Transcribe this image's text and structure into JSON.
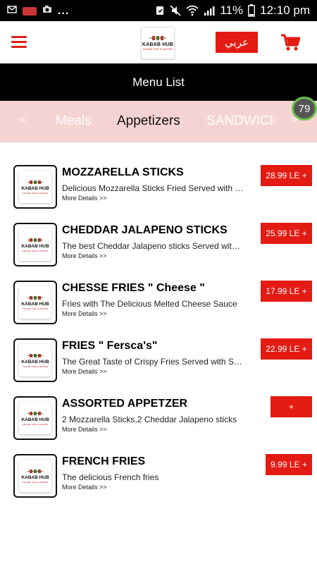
{
  "status_bar": {
    "battery": "11%",
    "time": "12:10 pm",
    "overflow": "..."
  },
  "header": {
    "logo_title": "KABAB HUB",
    "logo_tagline": "CHASE THE FLAVORS",
    "language_button": "عربي"
  },
  "title_bar": {
    "title": "Menu List"
  },
  "tabs": {
    "prev": "<",
    "next": ">",
    "items": [
      "Meals",
      "Appetizers",
      "SANDWICH"
    ],
    "selected": "Appetizers",
    "badge": "79"
  },
  "menu_items": [
    {
      "name": "MOZZARELLA STICKS",
      "description": "Delicious Mozzarella Sticks Fried Served with Ranch Sauce",
      "more": "More Details >>",
      "price": "28.99 LE +"
    },
    {
      "name": "CHEDDAR JALAPENO STICKS",
      "description": "The best Cheddar Jalapeno sticks Served with Ranch Sauce",
      "more": "More Details >>",
      "price": "25.99 LE +"
    },
    {
      "name": "CHESSE FRIES \" Cheese \"",
      "description": "Fries with The Delicious Melted Cheese Sauce",
      "more": "More Details >>",
      "price": "17.99 LE +"
    },
    {
      "name": "FRIES \" Fersca's\"",
      "description": "The Great Taste of Crispy Fries Served with Sauce",
      "more": "More Details >>",
      "price": "22.99 LE +"
    },
    {
      "name": "ASSORTED APPETZER",
      "description": "2 Mozzarella Sticks,2 Cheddar Jalapeno sticks",
      "more": "More Details >>",
      "price": "+"
    },
    {
      "name": "FRENCH FRIES",
      "description": "The delicious French fries",
      "more": "More Details >>",
      "price": "9.99 LE +"
    }
  ],
  "colors": {
    "accent_red": "#e31b13",
    "tab_bar_bg": "#f6d3d3",
    "title_bar_bg": "#000000"
  },
  "icons": [
    "menu-icon",
    "cart-icon",
    "wifi-icon",
    "signal-icon",
    "battery-icon",
    "mute-icon",
    "alarm-icon"
  ]
}
